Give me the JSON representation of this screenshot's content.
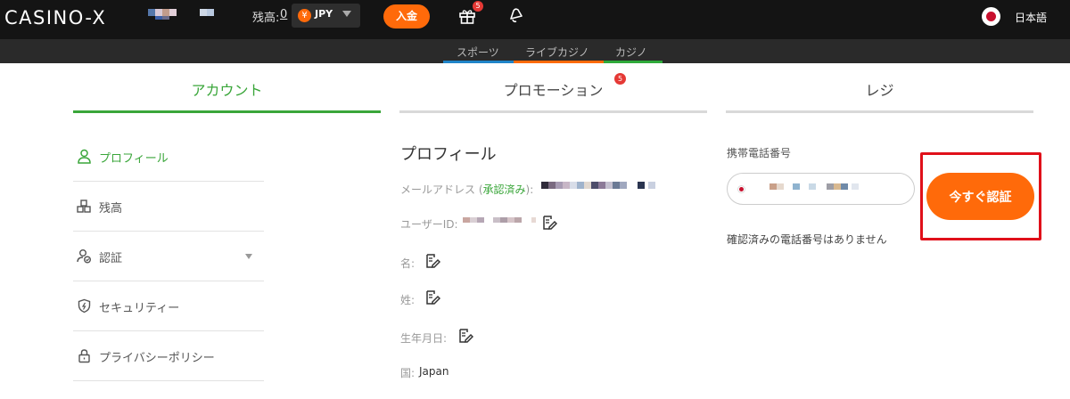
{
  "header": {
    "logo": "CASINO-X",
    "balance_label": "残高:",
    "balance_value": "0",
    "currency": "JPY",
    "currency_symbol": "¥",
    "deposit_label": "入金",
    "gift_badge": "5",
    "language": "日本語"
  },
  "subnav": {
    "items": [
      {
        "label": "スポーツ",
        "color": "#1f84c8"
      },
      {
        "label": "ライブカジノ",
        "color": "#ff6a0a"
      },
      {
        "label": "カジノ",
        "color": "#2eaa3a"
      }
    ]
  },
  "tabs": [
    {
      "label": "アカウント"
    },
    {
      "label": "プロモーション",
      "badge": "5"
    },
    {
      "label": "レジ"
    }
  ],
  "sidebar": {
    "items": [
      {
        "label": "プロフィール"
      },
      {
        "label": "残高"
      },
      {
        "label": "認証"
      },
      {
        "label": "セキュリティー"
      },
      {
        "label": "プライバシーポリシー"
      }
    ]
  },
  "profile": {
    "title": "プロフィール",
    "email_label": "メールアドレス (",
    "email_verified": "承認済み",
    "email_label_end": "):",
    "userid_label": "ユーザーID:",
    "first_name_label": "名:",
    "last_name_label": "姓:",
    "birthday_label": "生年月日:",
    "country_label": "国:",
    "country_value": "Japan"
  },
  "phone": {
    "label": "携帯電話番号",
    "verify_button": "今すぐ認証",
    "no_verified": "確認済みの電話番号はありません"
  },
  "colors": {
    "accent_green": "#3aa63a",
    "accent_orange": "#ff6a0a",
    "highlight_red": "#e0101a"
  }
}
